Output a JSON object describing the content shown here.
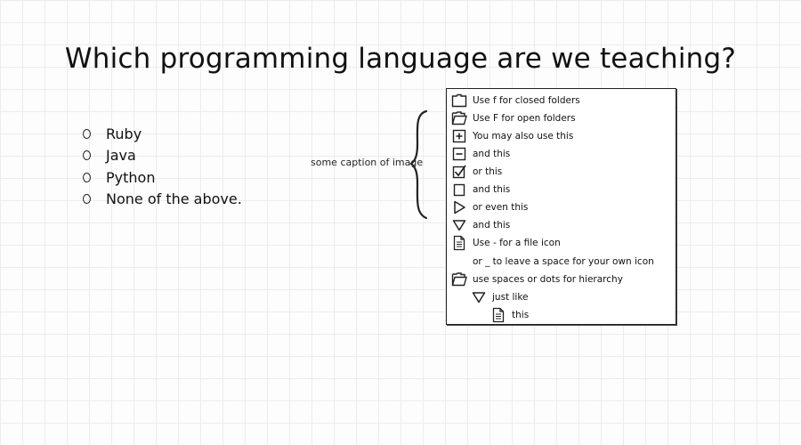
{
  "question": {
    "title": "Which programming language are we teaching?"
  },
  "options": [
    {
      "label": "Ruby"
    },
    {
      "label": "Java"
    },
    {
      "label": "Python"
    },
    {
      "label": "None of the above."
    }
  ],
  "caption": "some caption of image",
  "tree": {
    "rows": [
      {
        "icon": "closed-folder-icon",
        "label": "Use f for closed folders"
      },
      {
        "icon": "open-folder-icon",
        "label": "Use F for open folders"
      },
      {
        "icon": "plus-box-icon",
        "label": "You may also use this"
      },
      {
        "icon": "minus-box-icon",
        "label": "and this"
      },
      {
        "icon": "checkbox-checked-icon",
        "label": "or this"
      },
      {
        "icon": "checkbox-empty-icon",
        "label": "and this"
      },
      {
        "icon": "triangle-right-icon",
        "label": "or even this"
      },
      {
        "icon": "triangle-down-icon",
        "label": "and this"
      },
      {
        "icon": "file-icon",
        "label": "Use - for a file icon"
      },
      {
        "icon": "",
        "label": "or _ to leave a space for your own icon"
      },
      {
        "icon": "open-folder-icon",
        "label": "use spaces or dots for hierarchy"
      },
      {
        "icon": "triangle-down-icon",
        "label": "just like"
      },
      {
        "icon": "file-icon",
        "label": "this"
      }
    ]
  }
}
